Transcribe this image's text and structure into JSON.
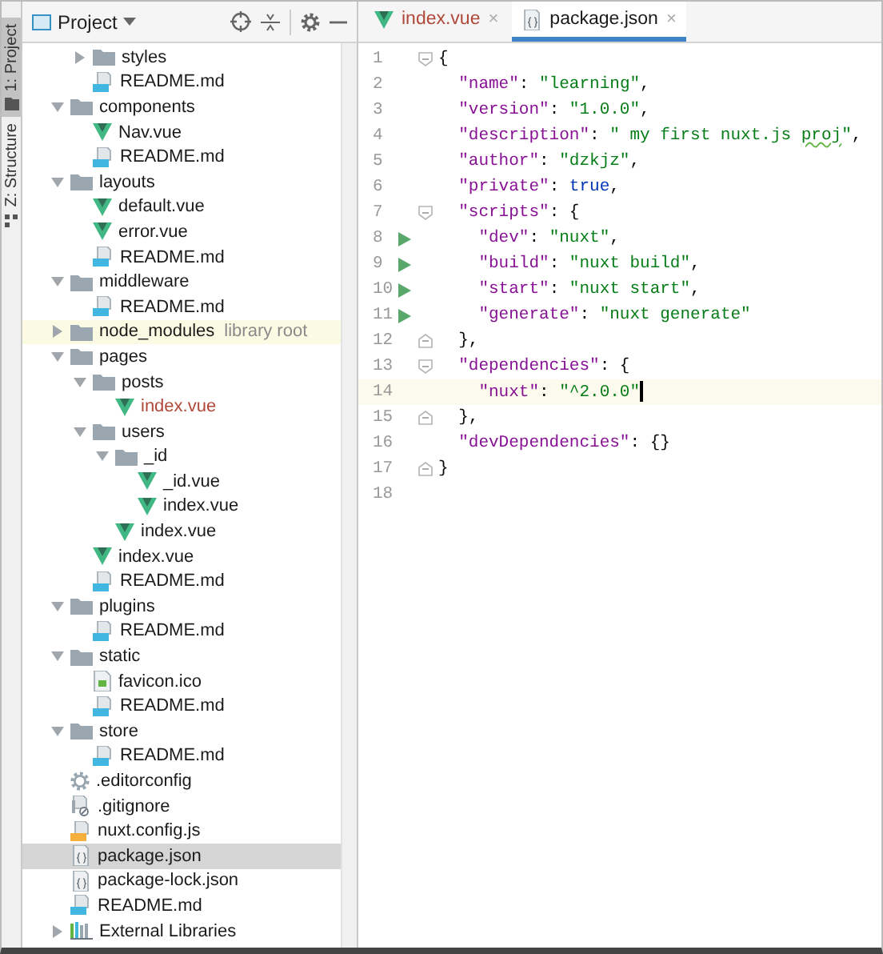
{
  "side_tabs": [
    {
      "label": "1: Project",
      "kind": "project",
      "selected": true
    },
    {
      "label": "Z: Structure",
      "kind": "structure",
      "selected": false
    }
  ],
  "project_panel": {
    "title": "Project"
  },
  "tree_clipped_children": [
    {
      "name": "styles",
      "kind": "folder",
      "expanded": false
    },
    {
      "name": "README.md",
      "kind": "md"
    }
  ],
  "tree": [
    {
      "name": "components",
      "kind": "folder",
      "expanded": true,
      "children": [
        {
          "name": "Nav.vue",
          "kind": "vue"
        },
        {
          "name": "README.md",
          "kind": "md"
        }
      ]
    },
    {
      "name": "layouts",
      "kind": "folder",
      "expanded": true,
      "children": [
        {
          "name": "default.vue",
          "kind": "vue"
        },
        {
          "name": "error.vue",
          "kind": "vue"
        },
        {
          "name": "README.md",
          "kind": "md"
        }
      ]
    },
    {
      "name": "middleware",
      "kind": "folder",
      "expanded": true,
      "children": [
        {
          "name": "README.md",
          "kind": "md"
        }
      ]
    },
    {
      "name": "node_modules",
      "kind": "folder",
      "expanded": false,
      "highlighted": true,
      "note": "library root"
    },
    {
      "name": "pages",
      "kind": "folder",
      "expanded": true,
      "children": [
        {
          "name": "posts",
          "kind": "folder",
          "expanded": true,
          "children": [
            {
              "name": "index.vue",
              "kind": "vue",
              "color": "#b0483a"
            }
          ]
        },
        {
          "name": "users",
          "kind": "folder",
          "expanded": true,
          "children": [
            {
              "name": "_id",
              "kind": "folder",
              "expanded": true,
              "children": [
                {
                  "name": "_id.vue",
                  "kind": "vue"
                },
                {
                  "name": "index.vue",
                  "kind": "vue"
                }
              ]
            },
            {
              "name": "index.vue",
              "kind": "vue"
            }
          ]
        },
        {
          "name": "index.vue",
          "kind": "vue"
        },
        {
          "name": "README.md",
          "kind": "md"
        }
      ]
    },
    {
      "name": "plugins",
      "kind": "folder",
      "expanded": true,
      "children": [
        {
          "name": "README.md",
          "kind": "md"
        }
      ]
    },
    {
      "name": "static",
      "kind": "folder",
      "expanded": true,
      "children": [
        {
          "name": "favicon.ico",
          "kind": "ico"
        },
        {
          "name": "README.md",
          "kind": "md"
        }
      ]
    },
    {
      "name": "store",
      "kind": "folder",
      "expanded": true,
      "children": [
        {
          "name": "README.md",
          "kind": "md"
        }
      ]
    },
    {
      "name": ".editorconfig",
      "kind": "config"
    },
    {
      "name": ".gitignore",
      "kind": "ignore"
    },
    {
      "name": "nuxt.config.js",
      "kind": "js"
    },
    {
      "name": "package.json",
      "kind": "json",
      "selected": true
    },
    {
      "name": "package-lock.json",
      "kind": "json",
      "selected": false
    },
    {
      "name": "README.md",
      "kind": "md"
    },
    {
      "name": "External Libraries",
      "kind": "library",
      "expanded": false
    }
  ],
  "editor": {
    "tabs": [
      {
        "label": "index.vue",
        "kind": "vue",
        "selected": false,
        "color": "#b0483a",
        "close": "×"
      },
      {
        "label": "package.json",
        "kind": "json",
        "selected": true,
        "close": "×"
      }
    ],
    "lines": [
      {
        "number": "1",
        "fold_start": true,
        "tokens": [
          {
            "kind": "punct",
            "text": "{"
          }
        ]
      },
      {
        "number": "2",
        "tokens": [
          {
            "kind": "key",
            "text": "  \"name\""
          },
          {
            "kind": "punct",
            "text": ": "
          },
          {
            "kind": "string",
            "text": "\"learning\""
          },
          {
            "kind": "punct",
            "text": ","
          }
        ]
      },
      {
        "number": "3",
        "tokens": [
          {
            "kind": "key",
            "text": "  \"version\""
          },
          {
            "kind": "punct",
            "text": ": "
          },
          {
            "kind": "string",
            "text": "\"1.0.0\""
          },
          {
            "kind": "punct",
            "text": ","
          }
        ]
      },
      {
        "number": "4",
        "tokens": [
          {
            "kind": "key",
            "text": "  \"description\""
          },
          {
            "kind": "punct",
            "text": ": "
          },
          {
            "kind": "string",
            "text": "\" my first nuxt.js "
          },
          {
            "kind": "string",
            "text": "proj",
            "typo": true
          },
          {
            "kind": "string",
            "text": "\""
          },
          {
            "kind": "punct",
            "text": ","
          }
        ]
      },
      {
        "number": "5",
        "tokens": [
          {
            "kind": "key",
            "text": "  \"author\""
          },
          {
            "kind": "punct",
            "text": ": "
          },
          {
            "kind": "string",
            "text": "\"dzkjz\""
          },
          {
            "kind": "punct",
            "text": ","
          }
        ]
      },
      {
        "number": "6",
        "tokens": [
          {
            "kind": "key",
            "text": "  \"private\""
          },
          {
            "kind": "punct",
            "text": ": "
          },
          {
            "kind": "keyword",
            "text": "true"
          },
          {
            "kind": "punct",
            "text": ","
          }
        ]
      },
      {
        "number": "7",
        "fold_start": true,
        "tokens": [
          {
            "kind": "key",
            "text": "  \"scripts\""
          },
          {
            "kind": "punct",
            "text": ": {"
          }
        ]
      },
      {
        "number": "8",
        "runnable": true,
        "tokens": [
          {
            "kind": "key",
            "text": "    \"dev\""
          },
          {
            "kind": "punct",
            "text": ": "
          },
          {
            "kind": "string",
            "text": "\"nuxt\""
          },
          {
            "kind": "punct",
            "text": ","
          }
        ]
      },
      {
        "number": "9",
        "runnable": true,
        "tokens": [
          {
            "kind": "key",
            "text": "    \"build\""
          },
          {
            "kind": "punct",
            "text": ": "
          },
          {
            "kind": "string",
            "text": "\"nuxt build\""
          },
          {
            "kind": "punct",
            "text": ","
          }
        ]
      },
      {
        "number": "10",
        "runnable": true,
        "tokens": [
          {
            "kind": "key",
            "text": "    \"start\""
          },
          {
            "kind": "punct",
            "text": ": "
          },
          {
            "kind": "string",
            "text": "\"nuxt start\""
          },
          {
            "kind": "punct",
            "text": ","
          }
        ]
      },
      {
        "number": "11",
        "runnable": true,
        "tokens": [
          {
            "kind": "key",
            "text": "    \"generate\""
          },
          {
            "kind": "punct",
            "text": ": "
          },
          {
            "kind": "string",
            "text": "\"nuxt generate\""
          }
        ]
      },
      {
        "number": "12",
        "fold_end": true,
        "tokens": [
          {
            "kind": "punct",
            "text": "  },"
          }
        ]
      },
      {
        "number": "13",
        "fold_start": true,
        "tokens": [
          {
            "kind": "key",
            "text": "  \"dependencies\""
          },
          {
            "kind": "punct",
            "text": ": {"
          }
        ]
      },
      {
        "number": "14",
        "current": true,
        "tokens": [
          {
            "kind": "key",
            "text": "    \"nuxt\""
          },
          {
            "kind": "punct",
            "text": ": "
          },
          {
            "kind": "string",
            "text": "\"^2.0.0\""
          }
        ]
      },
      {
        "number": "15",
        "fold_end": true,
        "tokens": [
          {
            "kind": "punct",
            "text": "  },"
          }
        ]
      },
      {
        "number": "16",
        "tokens": [
          {
            "kind": "key",
            "text": "  \"devDependencies\""
          },
          {
            "kind": "punct",
            "text": ": {}"
          }
        ]
      },
      {
        "number": "17",
        "fold_end": true,
        "tokens": [
          {
            "kind": "punct",
            "text": "}"
          }
        ]
      },
      {
        "number": "18"
      }
    ]
  }
}
